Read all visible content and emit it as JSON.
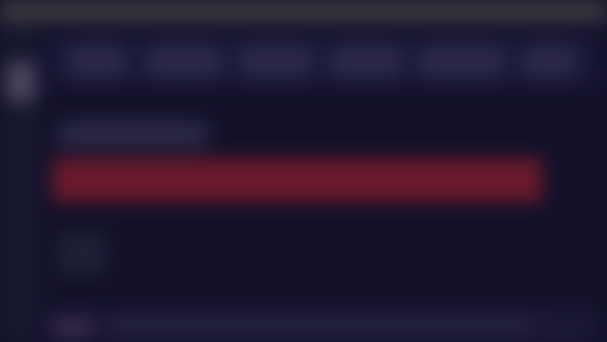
{
  "theme": {
    "background": "#13112a",
    "topbar": "#3a3a3f",
    "rail": "#181730",
    "toolbar": "#1a1838",
    "toolbar_button": "#2b2848",
    "banner": "#6a1a2c",
    "bottom_strip": "#1b1935"
  },
  "toolbar": {
    "items": [
      "",
      "",
      "",
      "",
      "",
      ""
    ]
  },
  "main": {
    "section_title": "",
    "alert_message": ""
  },
  "footer": {
    "status": ""
  }
}
